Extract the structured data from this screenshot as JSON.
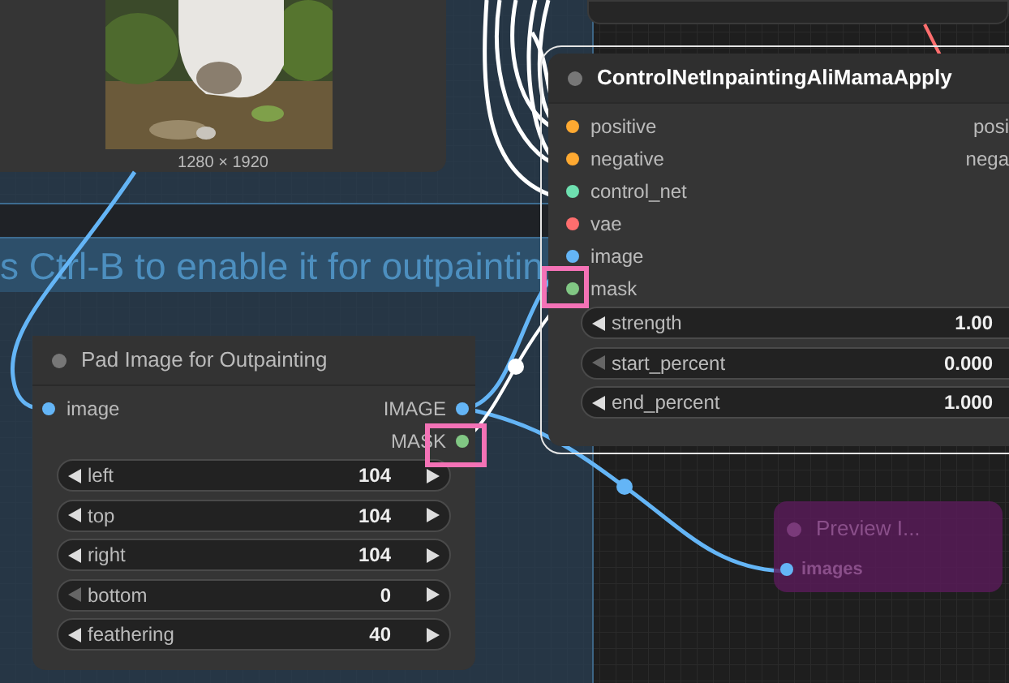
{
  "image_node": {
    "caption": "1280 × 1920"
  },
  "group": {
    "text": "s Ctrl-B to enable it for outpaintin"
  },
  "controlnet_node": {
    "title": "ControlNetInpaintingAliMamaApply",
    "selected": true,
    "inputs": [
      {
        "label": "positive",
        "color": "#ffa931"
      },
      {
        "label": "negative",
        "color": "#ffa931"
      },
      {
        "label": "control_net",
        "color": "#6ee0b0"
      },
      {
        "label": "vae",
        "color": "#ff6e6e"
      },
      {
        "label": "image",
        "color": "#64b5f6"
      },
      {
        "label": "mask",
        "color": "#81c784"
      }
    ],
    "outputs": [
      {
        "label": "posi"
      },
      {
        "label": "nega"
      }
    ],
    "widgets": [
      {
        "label": "strength",
        "value": "1.00",
        "at_min": false
      },
      {
        "label": "start_percent",
        "value": "0.000",
        "at_min": true
      },
      {
        "label": "end_percent",
        "value": "1.000",
        "at_min": false
      }
    ]
  },
  "pad_node": {
    "title": "Pad Image for Outpainting",
    "selected": false,
    "inputs": [
      {
        "label": "image",
        "color": "#64b5f6"
      }
    ],
    "outputs": [
      {
        "label": "IMAGE",
        "color": "#64b5f6"
      },
      {
        "label": "MASK",
        "color": "#81c784"
      }
    ],
    "widgets": [
      {
        "label": "left",
        "value": "104",
        "at_min": false
      },
      {
        "label": "top",
        "value": "104",
        "at_min": false
      },
      {
        "label": "right",
        "value": "104",
        "at_min": false
      },
      {
        "label": "bottom",
        "value": "0",
        "at_min": true
      },
      {
        "label": "feathering",
        "value": "40",
        "at_min": false
      }
    ]
  },
  "preview_node": {
    "title": "Preview I...",
    "input": {
      "label": "images",
      "color": "#64b5f6"
    }
  }
}
